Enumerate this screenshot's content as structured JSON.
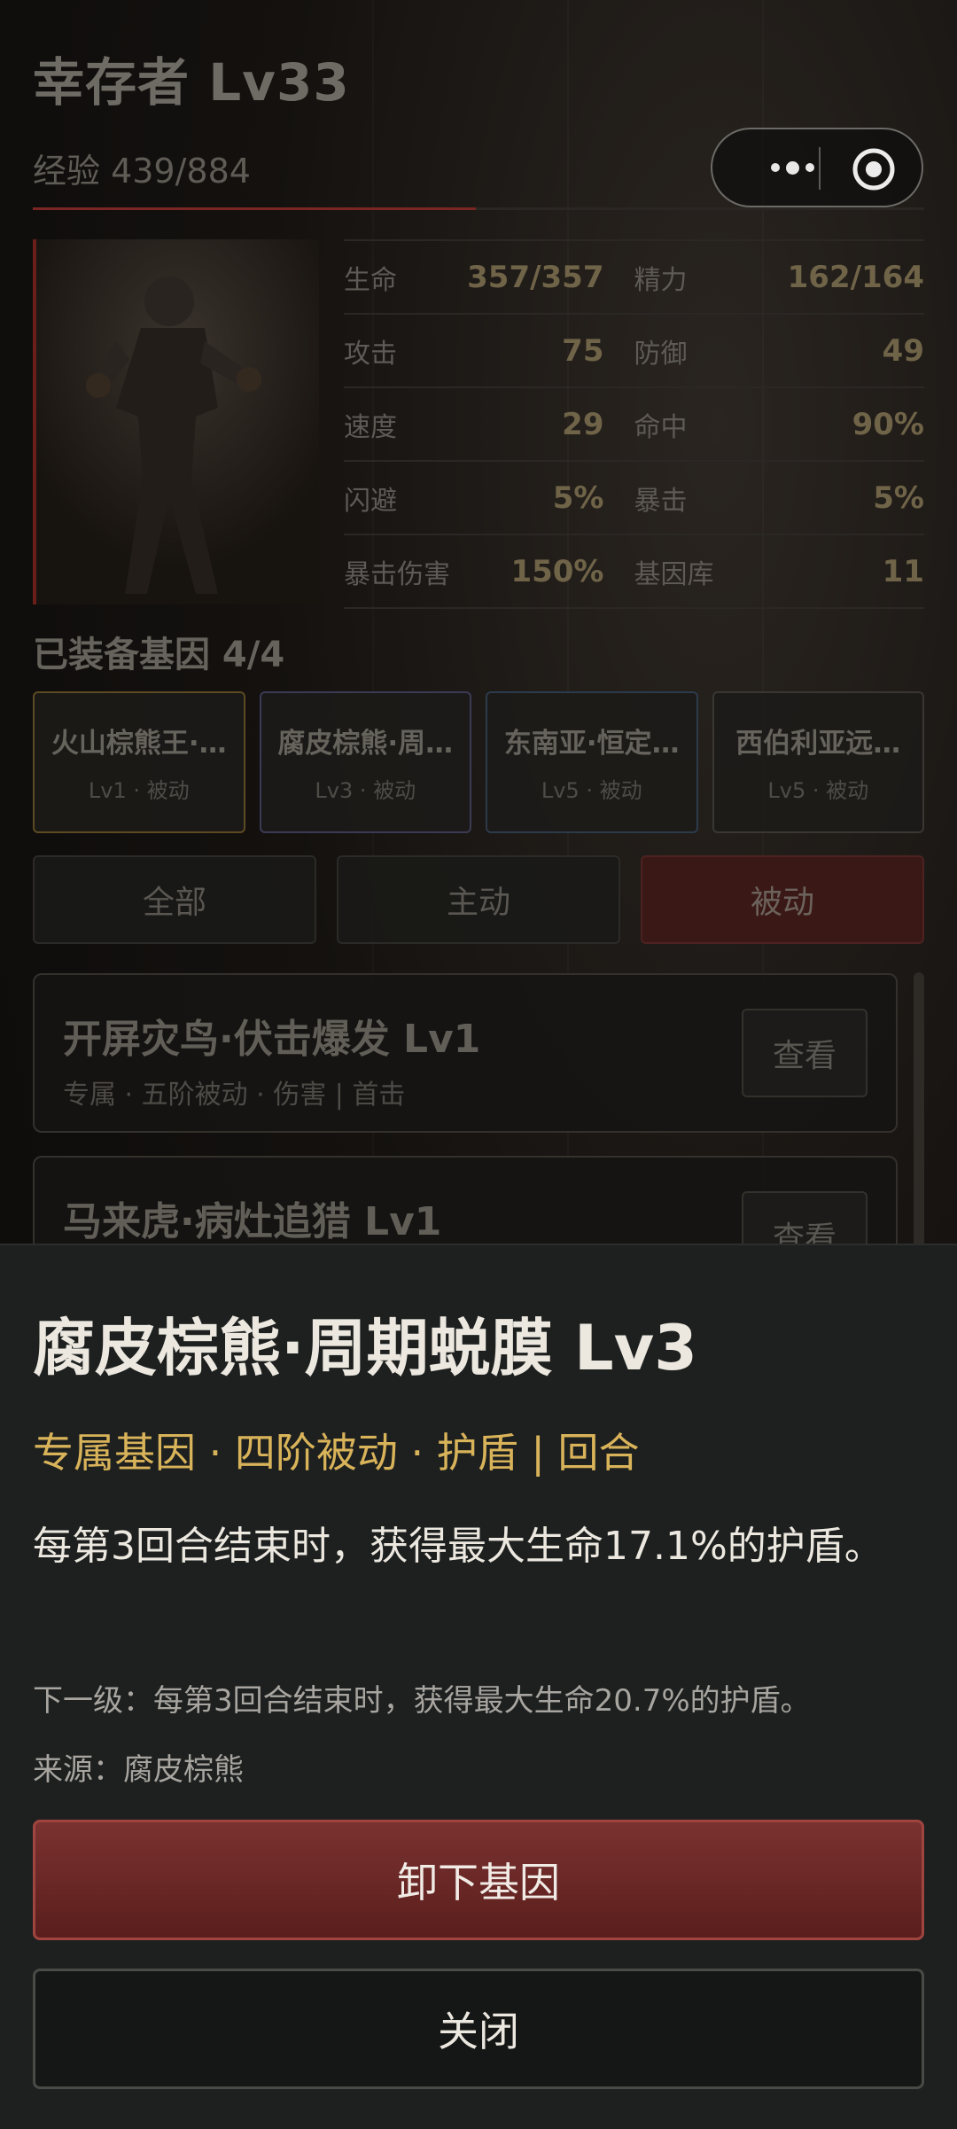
{
  "header": {
    "title": "幸存者 Lv33",
    "experience": "经验 439/884",
    "exp_progress": 0.497
  },
  "capsule": {
    "more_icon": "more-dots-icon",
    "close_icon": "target-circle-icon"
  },
  "stats": [
    [
      {
        "label": "生命",
        "value": "357/357"
      },
      {
        "label": "精力",
        "value": "162/164"
      }
    ],
    [
      {
        "label": "攻击",
        "value": "75"
      },
      {
        "label": "防御",
        "value": "49"
      }
    ],
    [
      {
        "label": "速度",
        "value": "29"
      },
      {
        "label": "命中",
        "value": "90%"
      }
    ],
    [
      {
        "label": "闪避",
        "value": "5%"
      },
      {
        "label": "暴击",
        "value": "5%"
      }
    ],
    [
      {
        "label": "暴击伤害",
        "value": "150%"
      },
      {
        "label": "基因库",
        "value": "11"
      }
    ]
  ],
  "equipped": {
    "title": "已装备基因 4/4",
    "genes": [
      {
        "name": "火山棕熊王·…",
        "meta": "Lv1 · 被动"
      },
      {
        "name": "腐皮棕熊·周…",
        "meta": "Lv3 · 被动"
      },
      {
        "name": "东南亚·恒定…",
        "meta": "Lv5 · 被动"
      },
      {
        "name": "西伯利亚远…",
        "meta": "Lv5 · 被动"
      }
    ]
  },
  "tabs": [
    "全部",
    "主动",
    "被动"
  ],
  "active_tab": 2,
  "skills": [
    {
      "name": "开屏灾鸟·伏击爆发 Lv1",
      "meta": "专属 · 五阶被动 · 伤害 | 首击",
      "button": "查看"
    },
    {
      "name": "马来虎·病灶追猎 Lv1",
      "meta": "",
      "button": "查看"
    }
  ],
  "modal": {
    "title": "腐皮棕熊·周期蜕膜 Lv3",
    "tags": "专属基因 · 四阶被动 · 护盾 | 回合",
    "description": "每第3回合结束时，获得最大生命17.1%的护盾。",
    "next_level": "下一级：每第3回合结束时，获得最大生命20.7%的护盾。",
    "source": "来源：腐皮棕熊",
    "unequip_label": "卸下基因",
    "close_label": "关闭"
  },
  "colors": {
    "accent_red": "#7a2622",
    "gold": "#d9b35a",
    "sheet_bg": "#1d201f"
  }
}
